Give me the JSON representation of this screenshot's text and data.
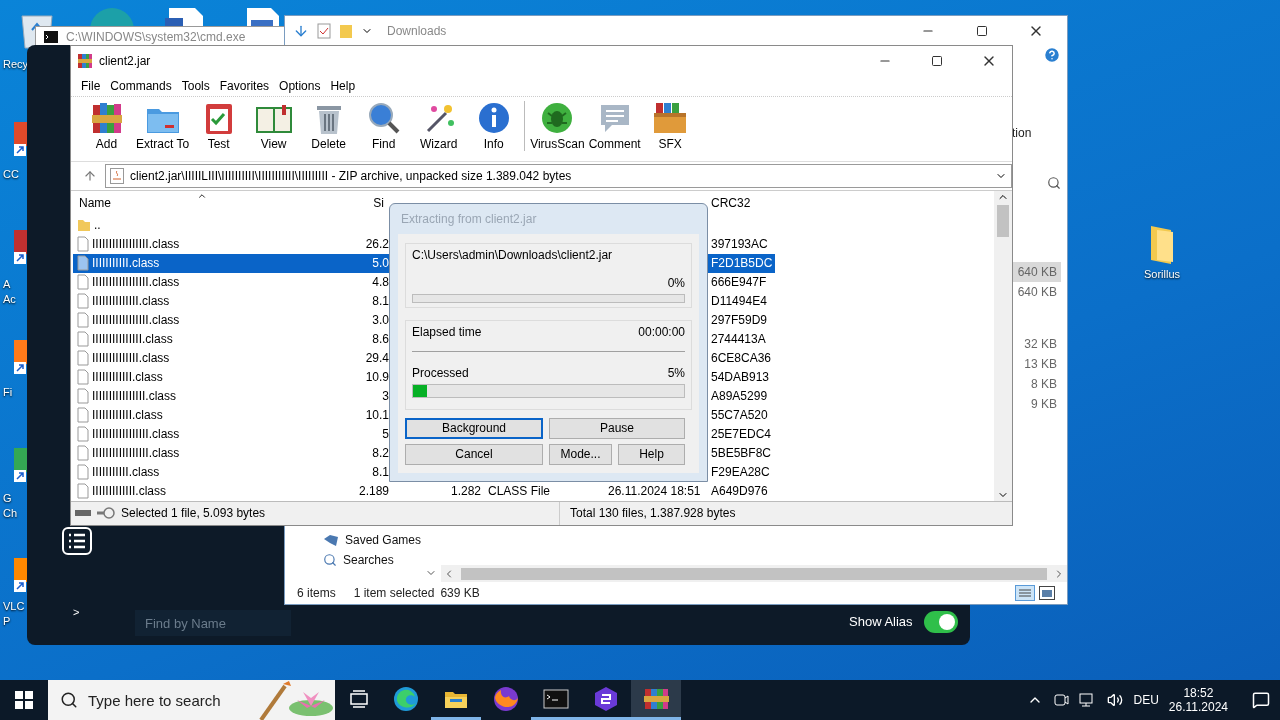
{
  "desktop": {
    "left_icons": [
      {
        "lines": [
          "Recy"
        ]
      },
      {
        "lines": [
          "CC"
        ]
      },
      {
        "lines": [
          "A",
          "Ac"
        ]
      },
      {
        "lines": [
          "Fi"
        ]
      },
      {
        "lines": [
          "G",
          "Ch"
        ]
      },
      {
        "lines": [
          "VLC",
          "P"
        ]
      }
    ],
    "right_icon": {
      "label": "Sorillus"
    }
  },
  "cmd_window": {
    "title": "C:\\WINDOWS\\system32\\cmd.exe"
  },
  "dark_app": {
    "prompt": ">",
    "search": {
      "placeholder": "Find by Name"
    },
    "show_alias": {
      "label": "Show Alias",
      "on": true
    }
  },
  "explorer": {
    "path": "Downloads",
    "partial_label": "tion",
    "sizes": [
      {
        "text": "640 KB",
        "selected": true
      },
      {
        "text": "640 KB",
        "selected": false
      },
      {
        "text": "32 KB",
        "selected": false
      },
      {
        "text": "13 KB",
        "selected": false
      },
      {
        "text": "8 KB",
        "selected": false
      },
      {
        "text": "9 KB",
        "selected": false
      }
    ],
    "nav": [
      "Saved Games",
      "Searches"
    ],
    "status": {
      "items": "6 items",
      "selection": "1 item selected",
      "size": "639 KB"
    }
  },
  "winrar": {
    "title": "client2.jar",
    "menu": [
      "File",
      "Commands",
      "Tools",
      "Favorites",
      "Options",
      "Help"
    ],
    "toolbar": [
      {
        "label": "Add"
      },
      {
        "label": "Extract To"
      },
      {
        "label": "Test"
      },
      {
        "label": "View"
      },
      {
        "label": "Delete"
      },
      {
        "label": "Find"
      },
      {
        "label": "Wizard"
      },
      {
        "label": "Info"
      },
      {
        "label": "VirusScan"
      },
      {
        "label": "Comment"
      },
      {
        "label": "SFX"
      }
    ],
    "address": "client2.jar\\IIIIILIII\\IIIIIIIIII\\IIIIIIIIIII\\IIIIIIIII - ZIP archive, unpacked size 1.389.042 bytes",
    "columns": {
      "name": "Name",
      "size": "Si",
      "crc": "CRC32"
    },
    "rows": [
      {
        "kind": "folder",
        "name": "..",
        "selected": false
      },
      {
        "kind": "file",
        "name": "IIIIIIIIIIIIIIIII.class",
        "size": "26.2",
        "crc": "397193AC",
        "selected": false
      },
      {
        "kind": "file",
        "name": "IIIIIIIIIII.class",
        "size": "5.0",
        "crc": "F2D1B5DC",
        "selected": true
      },
      {
        "kind": "file",
        "name": "IIIIIIIIIIIIIIIII.class",
        "size": "4.8",
        "crc": "666E947F",
        "selected": false
      },
      {
        "kind": "file",
        "name": "IIIIIIIIIIIIII.class",
        "size": "8.1",
        "crc": "D11494E4",
        "selected": false
      },
      {
        "kind": "file",
        "name": "IIIIIIIIIIIIIIIII.class",
        "size": "3.0",
        "crc": "297F59D9",
        "selected": false
      },
      {
        "kind": "file",
        "name": "IIIIIIIIIIIIIII.class",
        "size": "8.6",
        "crc": "2744413A",
        "selected": false
      },
      {
        "kind": "file",
        "name": "IIIIIIIIIIIIII.class",
        "size": "29.4",
        "crc": "6CE8CA36",
        "selected": false
      },
      {
        "kind": "file",
        "name": "IIIIIIIIIIII.class",
        "size": "10.9",
        "crc": "54DAB913",
        "selected": false
      },
      {
        "kind": "file",
        "name": "IIIIIIIIIIIIIIII.class",
        "size": "3",
        "crc": "A89A5299",
        "selected": false
      },
      {
        "kind": "file",
        "name": "IIIIIIIIIIII.class",
        "size": "10.1",
        "crc": "55C7A520",
        "selected": false
      },
      {
        "kind": "file",
        "name": "IIIIIIIIIIIIIIIII.class",
        "size": "5",
        "crc": "25E7EDC4",
        "selected": false
      },
      {
        "kind": "file",
        "name": "IIIIIIIIIIIIIIIII.class",
        "size": "8.2",
        "crc": "5BE5BF8C",
        "selected": false
      },
      {
        "kind": "file",
        "name": "IIIIIIIIIII.class",
        "size": "8.1",
        "crc": "F29EA28C",
        "selected": false
      },
      {
        "kind": "file",
        "name": "IIIIIIIIIIIII.class",
        "size": "2.189",
        "packed": "1.282",
        "type": "CLASS File",
        "modified": "26.11.2024 18:51",
        "crc": "A649D976",
        "selected": false
      }
    ],
    "status_left": "Selected 1 file, 5.093 bytes",
    "status_right": "Total 130 files, 1.387.928 bytes"
  },
  "dialog": {
    "title": "Extracting from client2.jar",
    "path": "C:\\Users\\admin\\Downloads\\client2.jar",
    "file_percent": "0%",
    "file_bar": {
      "level": 0
    },
    "elapsed_label": "Elapsed time",
    "elapsed": "00:00:00",
    "processed_label": "Processed",
    "processed_percent": "5%",
    "processed_bar": {
      "level": 0.05
    },
    "buttons": [
      {
        "label": "Background",
        "focused": true
      },
      {
        "label": "Pause",
        "focused": false
      },
      {
        "label": "Cancel",
        "focused": false
      },
      {
        "label": "Mode...",
        "focused": false
      },
      {
        "label": "Help",
        "focused": false
      }
    ]
  },
  "taskbar": {
    "search_placeholder": "Type here to search",
    "apps": [
      {
        "running": false,
        "active": false
      },
      {
        "running": false,
        "active": false
      },
      {
        "running": true,
        "active": false
      },
      {
        "running": false,
        "active": false
      },
      {
        "running": true,
        "active": false
      },
      {
        "running": true,
        "active": false
      },
      {
        "running": true,
        "active": true
      }
    ],
    "language": "DEU",
    "time": "18:52",
    "date": "26.11.2024"
  }
}
